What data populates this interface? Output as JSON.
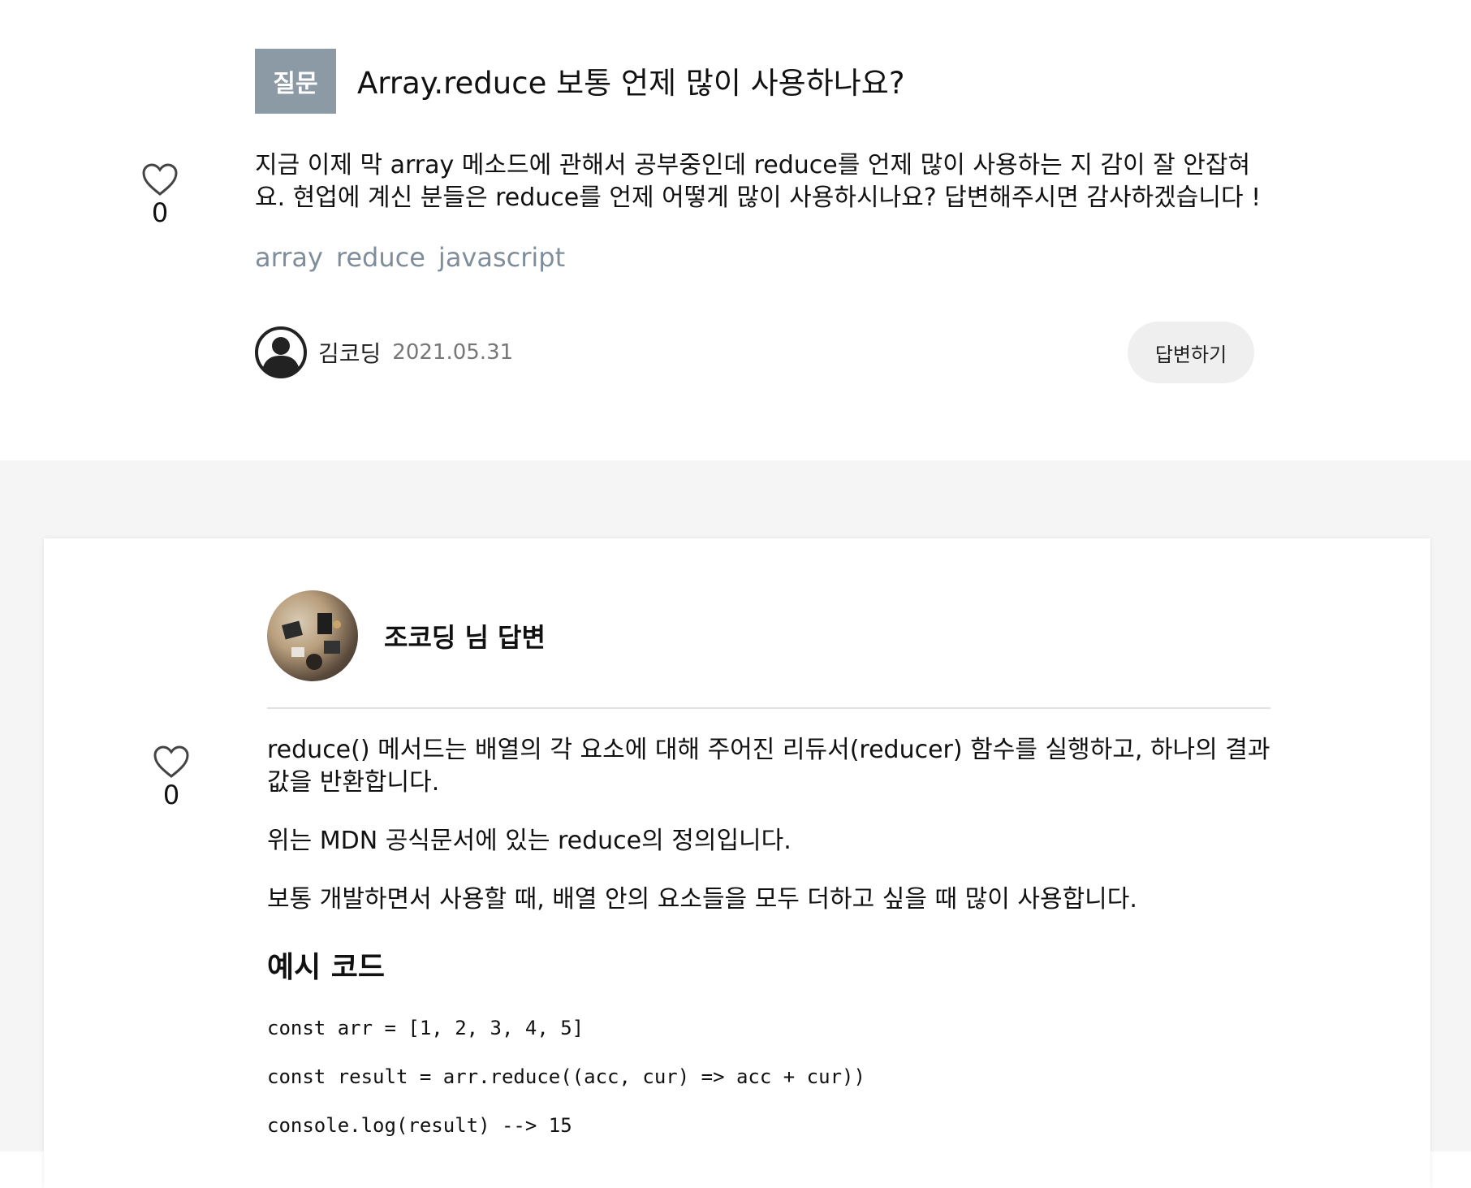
{
  "question": {
    "badge": "질문",
    "title": "Array.reduce 보통 언제 많이 사용하나요?",
    "likes": "0",
    "body": "지금 이제 막 array 메소드에 관해서 공부중인데 reduce를 언제 많이 사용하는 지 감이 잘 안잡혀요. 현업에 계신 분들은 reduce를 언제 어떻게 많이 사용하시나요? 답변해주시면 감사하겠습니다 !",
    "tags": [
      "array",
      "reduce",
      "javascript"
    ],
    "author": "김코딩",
    "date": "2021.05.31",
    "answer_button": "답변하기"
  },
  "answer": {
    "author_heading": "조코딩 님 답변",
    "likes": "0",
    "paragraphs": [
      "reduce() 메서드는 배열의 각 요소에 대해 주어진 리듀서(reducer) 함수를 실행하고, 하나의 결과값을 반환합니다.",
      "위는 MDN 공식문서에 있는 reduce의 정의입니다.",
      "보통 개발하면서 사용할 때, 배열 안의 요소들을 모두 더하고 싶을 때 많이 사용합니다."
    ],
    "section_title": "예시 코드",
    "code_lines": [
      "const arr = [1, 2, 3, 4, 5]",
      "const result = arr.reduce((acc, cur) => acc + cur))",
      "console.log(result) --> 15"
    ]
  },
  "colors": {
    "badge_bg": "#8c9aa6",
    "tag_text": "#7f8e9a",
    "page_gray": "#f5f5f5",
    "button_bg": "#efefef"
  }
}
